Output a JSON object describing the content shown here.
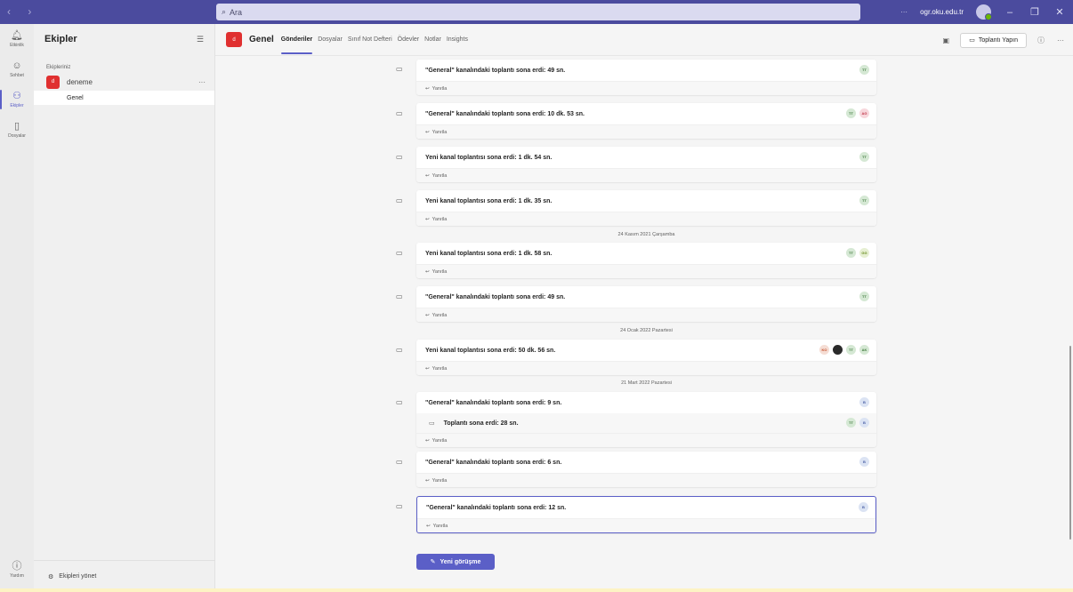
{
  "titlebar": {
    "search_placeholder": "Ara",
    "more": "···",
    "account": "ogr.oku.edu.tr"
  },
  "rail": {
    "items": [
      {
        "label": "Etkinlik",
        "icon": "bell-icon"
      },
      {
        "label": "Sohbet",
        "icon": "chat-icon"
      },
      {
        "label": "Ekipler",
        "icon": "teams-icon"
      },
      {
        "label": "Dosyalar",
        "icon": "file-icon"
      }
    ],
    "help_label": "Yardım"
  },
  "teams": {
    "title": "Ekipler",
    "section_label": "Ekipleriniz",
    "team": {
      "badge": "d",
      "name": "deneme",
      "more": "···"
    },
    "channel": "Genel",
    "manage": "Ekipleri yönet"
  },
  "channel": {
    "badge": "d",
    "name": "Genel",
    "tabs": [
      "Gönderiler",
      "Dosyalar",
      "Sınıf Not Defteri",
      "Ödevler",
      "Notlar",
      "Insights"
    ],
    "meet_button": "Toplantı Yapın",
    "more": "···"
  },
  "feed": {
    "reply_label": "Yanıtla",
    "messages": [
      {
        "text": "\"General\" kanalındaki toplantı sona erdi: 49 sn.",
        "participants": [
          "TT"
        ]
      },
      {
        "text": "\"General\" kanalındaki toplantı sona erdi: 10 dk. 53 sn.",
        "participants": [
          "TT",
          "AG"
        ]
      },
      {
        "text": "Yeni kanal toplantısı sona erdi: 1 dk. 54 sn.",
        "participants": [
          "TT"
        ]
      },
      {
        "text": "Yeni kanal toplantısı sona erdi: 1 dk. 35 sn.",
        "participants": [
          "TT"
        ]
      },
      {
        "text": "Yeni kanal toplantısı sona erdi: 1 dk. 58 sn.",
        "participants": [
          "TT",
          "GG"
        ]
      },
      {
        "text": "\"General\" kanalındaki toplantı sona erdi: 49 sn.",
        "participants": [
          "TT"
        ]
      },
      {
        "text": "Yeni kanal toplantısı sona erdi: 50 dk. 56 sn.",
        "participants": [
          "KO",
          "",
          "TT",
          "AK"
        ]
      },
      {
        "text": "\"General\" kanalındaki toplantı sona erdi: 9 sn.",
        "participants": [
          "B"
        ],
        "nested": {
          "text": "Toplantı sona erdi: 28 sn.",
          "participants": [
            "TT",
            "B"
          ]
        }
      },
      {
        "text": "\"General\" kanalındaki toplantı sona erdi: 6 sn.",
        "participants": [
          "B"
        ]
      },
      {
        "text": "\"General\" kanalındaki toplantı sona erdi: 12 sn.",
        "participants": [
          "B"
        ]
      }
    ],
    "date_separators": [
      "24 Kasım 2021 Çarşamba",
      "24 Ocak 2022 Pazartesi",
      "21 Mart 2022 Pazartesi"
    ],
    "new_conversation": "Yeni görüşme"
  }
}
